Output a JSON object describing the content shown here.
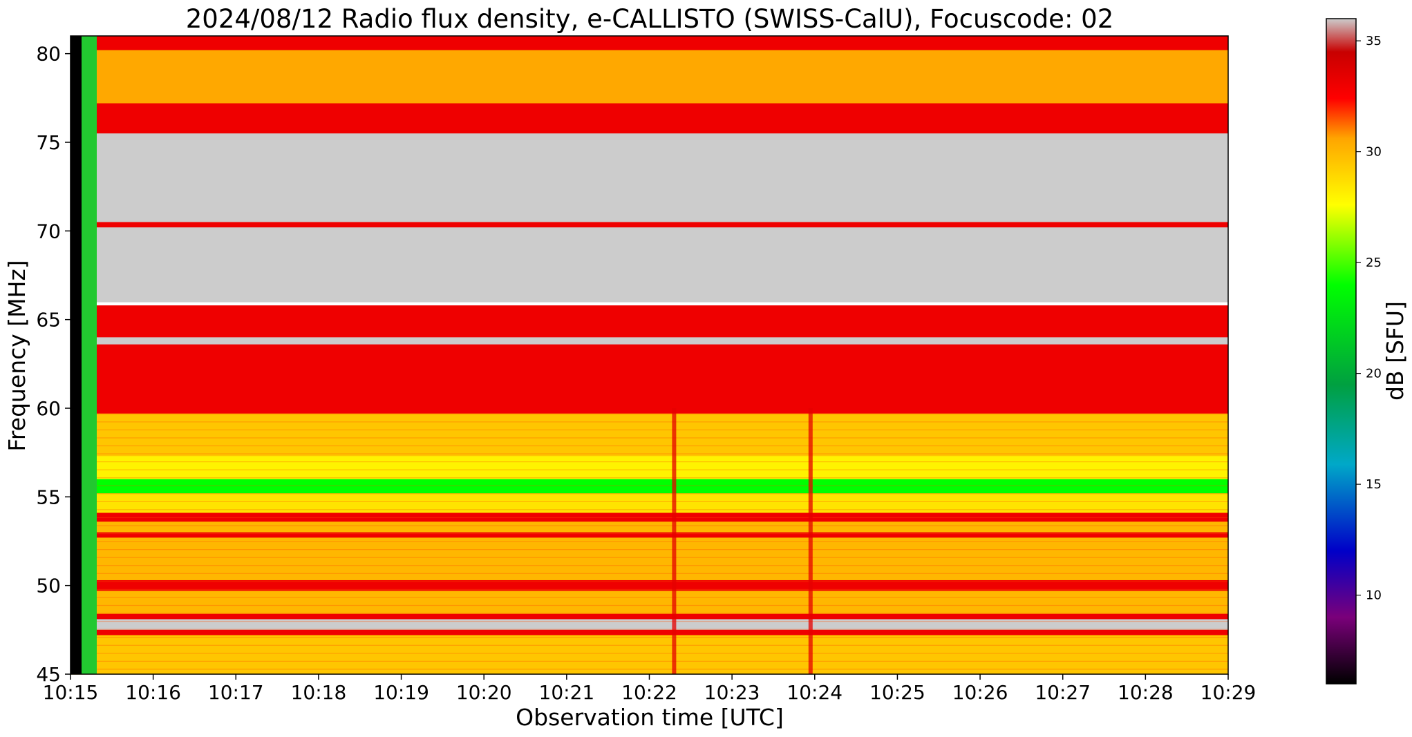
{
  "chart_data": {
    "type": "heatmap",
    "title": "2024/08/12  Radio flux density, e-CALLISTO (SWISS-CalU), Focuscode: 02",
    "xlabel": "Observation time [UTC]",
    "ylabel": "Frequency [MHz]",
    "x_tick_labels": [
      "10:15",
      "10:16",
      "10:17",
      "10:18",
      "10:19",
      "10:20",
      "10:21",
      "10:22",
      "10:23",
      "10:24",
      "10:25",
      "10:26",
      "10:27",
      "10:28",
      "10:29"
    ],
    "x_range_minutes": [
      0,
      14
    ],
    "y_ticks": [
      45,
      50,
      55,
      60,
      65,
      70,
      75,
      80
    ],
    "ylim": [
      45,
      81
    ],
    "colorbar": {
      "label": "dB [SFU]",
      "ticks": [
        10,
        15,
        20,
        25,
        30,
        35
      ],
      "range": [
        6,
        36
      ],
      "colors": [
        "#000000",
        "#7a007a",
        "#0000c8",
        "#00a8c8",
        "#00a040",
        "#00ff00",
        "#ffff00",
        "#ffa500",
        "#ff0000",
        "#c80000",
        "#cccccc"
      ]
    },
    "bands": [
      {
        "f0": 80.2,
        "f1": 81.0,
        "value": 33
      },
      {
        "f0": 77.2,
        "f1": 80.2,
        "value": 30.5
      },
      {
        "f0": 75.5,
        "f1": 77.2,
        "value": 33
      },
      {
        "f0": 70.5,
        "f1": 75.5,
        "value": 36
      },
      {
        "f0": 70.2,
        "f1": 70.5,
        "value": 33
      },
      {
        "f0": 66.0,
        "f1": 70.2,
        "value": 36
      },
      {
        "f0": 64.0,
        "f1": 65.8,
        "value": 33
      },
      {
        "f0": 63.6,
        "f1": 64.0,
        "value": 36
      },
      {
        "f0": 59.7,
        "f1": 63.6,
        "value": 33
      },
      {
        "f0": 57.3,
        "f1": 59.7,
        "value": 29.5
      },
      {
        "f0": 56.0,
        "f1": 57.3,
        "value": 28
      },
      {
        "f0": 55.2,
        "f1": 56.0,
        "value": 24
      },
      {
        "f0": 54.1,
        "f1": 55.2,
        "value": 28.5
      },
      {
        "f0": 53.6,
        "f1": 54.1,
        "value": 33
      },
      {
        "f0": 53.0,
        "f1": 53.6,
        "value": 30
      },
      {
        "f0": 52.7,
        "f1": 53.0,
        "value": 33
      },
      {
        "f0": 50.3,
        "f1": 52.7,
        "value": 30
      },
      {
        "f0": 49.7,
        "f1": 50.3,
        "value": 33
      },
      {
        "f0": 48.4,
        "f1": 49.7,
        "value": 30
      },
      {
        "f0": 48.1,
        "f1": 48.4,
        "value": 33
      },
      {
        "f0": 47.5,
        "f1": 48.1,
        "value": 36
      },
      {
        "f0": 47.2,
        "f1": 47.5,
        "value": 33
      },
      {
        "f0": 45.0,
        "f1": 47.2,
        "value": 29.5
      }
    ],
    "vertical_bursts_minutes": [
      7.3,
      8.95
    ]
  }
}
